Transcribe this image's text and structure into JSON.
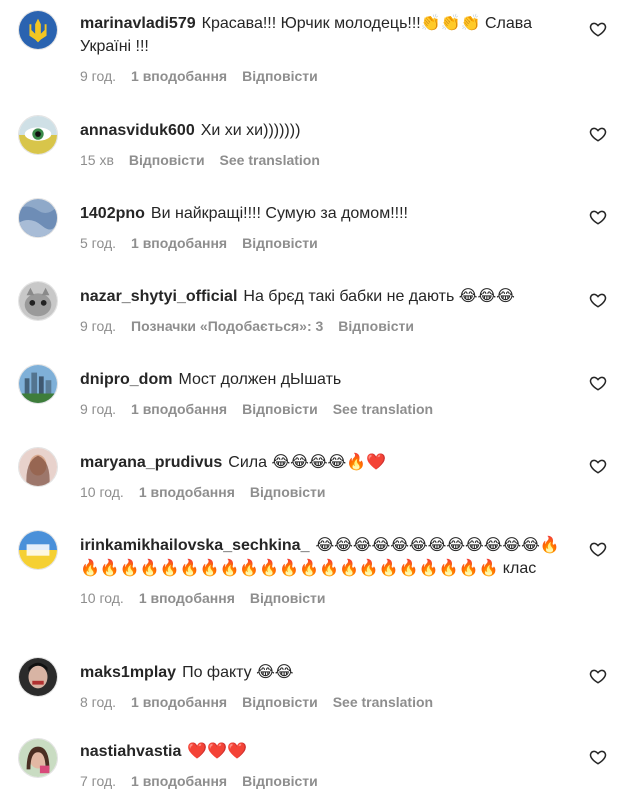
{
  "comments": [
    {
      "username": "marinavladi579",
      "text": "Красава!!! Юрчик молодець!!!👏👏👏 Слава Україні !!!",
      "time": "9 год.",
      "likes": "1 вподобання",
      "reply": "Відповісти",
      "translate": "",
      "avatar_icon": "ukraine-trident-avatar"
    },
    {
      "username": "annasviduk600",
      "text": "Хи хи хи)))))))",
      "time": "15 хв",
      "likes": "",
      "reply": "Відповісти",
      "translate": "See translation",
      "avatar_icon": "eye-avatar"
    },
    {
      "username": "1402pno",
      "text": "Ви найкращі!!!! Сумую за домом!!!!",
      "time": "5 год.",
      "likes": "1 вподобання",
      "reply": "Відповісти",
      "translate": "",
      "avatar_icon": "blue-fabric-avatar"
    },
    {
      "username": "nazar_shytyi_official",
      "text": "На брєд такі бабки не дають 😂😂😂",
      "time": "9 год.",
      "likes": "Позначки «Подобається»: 3",
      "reply": "Відповісти",
      "translate": "",
      "avatar_icon": "cat-avatar"
    },
    {
      "username": "dnipro_dom",
      "text": "Мост должен дЫшать",
      "time": "9 год.",
      "likes": "1 вподобання",
      "reply": "Відповісти",
      "translate": "See translation",
      "avatar_icon": "city-avatar"
    },
    {
      "username": "maryana_prudivus",
      "text": "Сила 😂😂😂😂🔥❤️",
      "time": "10 год.",
      "likes": "1 вподобання",
      "reply": "Відповісти",
      "translate": "",
      "avatar_icon": "woman-portrait-avatar"
    },
    {
      "username": "irinkamikhailovska_sechkina_",
      "text": "😂😂😂😂😂😂😂😂😂😂😂😂🔥🔥🔥🔥🔥🔥🔥🔥🔥🔥🔥🔥🔥🔥🔥🔥🔥🔥🔥🔥🔥🔥 клас",
      "time": "10 год.",
      "likes": "1 вподобання",
      "reply": "Відповісти",
      "translate": "",
      "avatar_icon": "flag-avatar"
    },
    {
      "username": "maks1mplay",
      "text": "По факту 😂😂",
      "time": "8 год.",
      "likes": "1 вподобання",
      "reply": "Відповісти",
      "translate": "See translation",
      "avatar_icon": "dark-portrait-avatar"
    },
    {
      "username": "nastiahvastia",
      "text": "❤️❤️❤️",
      "time": "7 год.",
      "likes": "1 вподобання",
      "reply": "Відповісти",
      "translate": "",
      "avatar_icon": "girl-portrait-avatar"
    }
  ],
  "colors": {
    "text": "#262626",
    "meta": "#8e8e8e",
    "heart_red": "#e0213b"
  }
}
